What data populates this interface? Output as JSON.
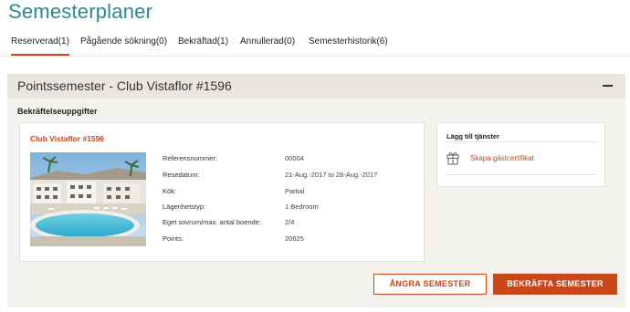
{
  "page": {
    "title": "Semesterplaner"
  },
  "tabs": [
    {
      "label": "Reserverad(1)",
      "active": true
    },
    {
      "label": "Pågående sökning(0)",
      "active": false
    },
    {
      "label": "Bekräftad(1)",
      "active": false
    },
    {
      "label": "Annullerad(0)",
      "active": false
    },
    {
      "label": "Semesterhistorik(6)",
      "active": false
    }
  ],
  "panel": {
    "title": "Pointssemester - Club Vistaflor #1596",
    "collapse_icon": "minus-icon",
    "section_title": "Bekräftelseuppgifter"
  },
  "booking": {
    "resort_name": "Club Vistaflor #1596",
    "details": [
      {
        "label": "Referensnummer:",
        "value": "00004"
      },
      {
        "label": "Resedatum:",
        "value": "21-Aug.-2017 to 28-Aug.-2017"
      },
      {
        "label": "Kök:",
        "value": "Partial"
      },
      {
        "label": "Lägenhetstyp:",
        "value": "1 Bedroom"
      },
      {
        "label": "Eget sovrum/max. antal boende:",
        "value": "2/4"
      },
      {
        "label": "Points:",
        "value": "20625"
      }
    ]
  },
  "services": {
    "title": "Lägg till tjänster",
    "link_label": "Skapa gästcertifikat",
    "icon": "gift-icon"
  },
  "actions": {
    "cancel_label": "ÅNGRA SEMESTER",
    "confirm_label": "BEKRÄFTA SEMESTER"
  },
  "colors": {
    "title": "#2a8a93",
    "accent": "#c8471b",
    "panel_bg": "#f4f2ef",
    "panel_header_bg": "#e9e5df"
  }
}
